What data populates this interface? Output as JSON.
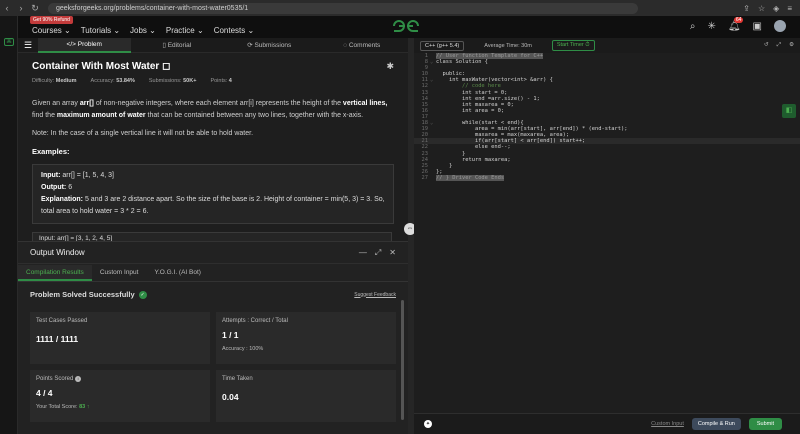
{
  "browser": {
    "url": "geeksforgeeks.org/problems/container-with-most-water0535/1"
  },
  "topnav": {
    "badge": "Get 90% Refund",
    "menu": [
      "Courses ⌄",
      "Tutorials ⌄",
      "Jobs ⌄",
      "Practice ⌄",
      "Contests ⌄"
    ],
    "brand": "GG",
    "notif_count": "64"
  },
  "tabs": [
    "Problem",
    "Editorial",
    "Submissions",
    "Comments"
  ],
  "problem": {
    "title": "Container With Most Water",
    "difficulty_label": "Difficulty:",
    "difficulty": "Medium",
    "accuracy_label": "Accuracy:",
    "accuracy": "53.84%",
    "submissions_label": "Submissions:",
    "submissions": "50K+",
    "points_label": "Points:",
    "points": "4",
    "desc_1": "Given an array ",
    "desc_arr": "arr[]",
    "desc_2": " of non-negative integers, where each element arr[i] represents the height of the ",
    "desc_vl": "vertical lines,",
    "desc_3": " find the ",
    "desc_max": "maximum amount of water",
    "desc_4": " that can be contained between any two lines, together with the x-axis.",
    "note": "Note: In the case of a single vertical line it will not be able to hold water.",
    "examples_label": "Examples:",
    "ex1_input_label": "Input:",
    "ex1_input": " arr[] = [1, 5, 4, 3]",
    "ex1_output_label": "Output:",
    "ex1_output": " 6",
    "ex1_expl_label": "Explanation:",
    "ex1_expl": " 5 and 3 are 2 distance apart. So the size of the base is 2. Height of container = min(5, 3) = 3. So, total area to hold water = 3 * 2 = 6.",
    "ex2_partial": "Input: arr[] = [3, 1, 2, 4, 5]"
  },
  "output": {
    "title": "Output Window",
    "tabs": [
      "Compilation Results",
      "Custom Input",
      "Y.O.G.I. (AI Bot)"
    ],
    "status": "Problem Solved Successfully",
    "feedback": "Suggest Feedback",
    "cards": {
      "tests_label": "Test Cases Passed",
      "tests_value": "1111 / 1111",
      "attempts_label": "Attempts : Correct / Total",
      "attempts_value": "1 / 1",
      "accuracy_text": "Accuracy : 100%",
      "points_label": "Points Scored",
      "points_value": "4 / 4",
      "total_label": "Your Total Score:",
      "total_value": "83 ↑",
      "time_label": "Time Taken",
      "time_value": "0.04"
    }
  },
  "editor": {
    "language": "C++ (g++ 5.4)",
    "avg_time": "Average Time: 30m",
    "timer": "Start Timer ⏱",
    "lines": [
      {
        "n": "1",
        "t": "// User function Template for C++",
        "c": "hl"
      },
      {
        "n": "8",
        "t": "class Solution {",
        "c": ""
      },
      {
        "n": "9",
        "t": "",
        "c": ""
      },
      {
        "n": "10",
        "t": "  public:",
        "c": ""
      },
      {
        "n": "11",
        "t": "    int maxWater(vector<int> &arr) {",
        "c": ""
      },
      {
        "n": "12",
        "t": "        // code here",
        "c": "cm"
      },
      {
        "n": "13",
        "t": "        int start = 0;",
        "c": ""
      },
      {
        "n": "14",
        "t": "        int end =arr.size() - 1;",
        "c": ""
      },
      {
        "n": "15",
        "t": "        int maxarea = 0;",
        "c": ""
      },
      {
        "n": "16",
        "t": "        int area = 0;",
        "c": ""
      },
      {
        "n": "17",
        "t": "",
        "c": ""
      },
      {
        "n": "18",
        "t": "        while(start < end){",
        "c": ""
      },
      {
        "n": "19",
        "t": "            area = min(arr[start], arr[end]) * (end-start);",
        "c": ""
      },
      {
        "n": "20",
        "t": "            maxarea = max(maxarea, area);",
        "c": ""
      },
      {
        "n": "21",
        "t": "            if(arr[start] < arr[end]) start++;",
        "c": ""
      },
      {
        "n": "22",
        "t": "            else end--;",
        "c": ""
      },
      {
        "n": "23",
        "t": "        }",
        "c": ""
      },
      {
        "n": "24",
        "t": "        return maxarea;",
        "c": ""
      },
      {
        "n": "25",
        "t": "    }",
        "c": ""
      },
      {
        "n": "26",
        "t": "};",
        "c": ""
      },
      {
        "n": "27",
        "t": "// } Driver Code Ends",
        "c": "hl"
      }
    ],
    "custom_input": "Custom Input",
    "compile_run": "Compile & Run",
    "submit": "Submit"
  }
}
